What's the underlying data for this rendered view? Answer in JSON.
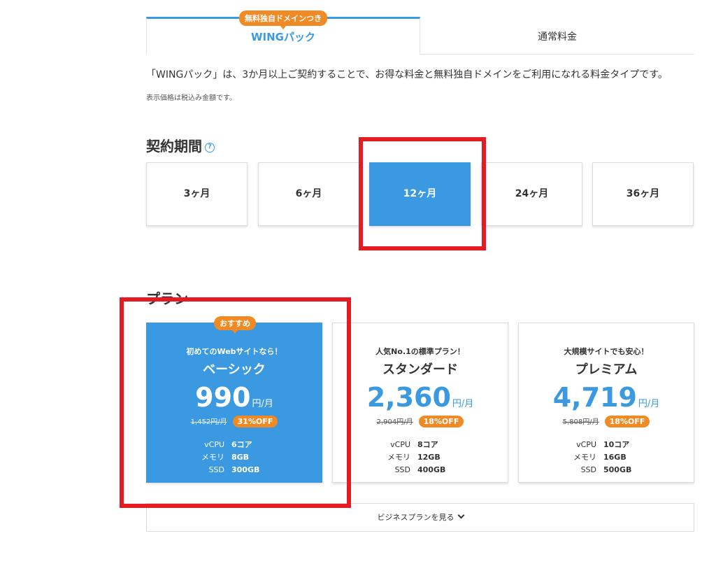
{
  "tabs": {
    "wing": {
      "label": "WINGパック",
      "badge": "無料独自ドメインつき"
    },
    "normal": {
      "label": "通常料金"
    }
  },
  "description": "「WINGパック」は、3か月以上ご契約することで、お得な料金と無料独自ドメインをご利用になれる料金タイプです。",
  "tax_note": "表示価格は税込み金額です。",
  "period_section": {
    "title": "契約期間",
    "help_icon": "?",
    "options": [
      "3ヶ月",
      "6ヶ月",
      "12ヶ月",
      "24ヶ月",
      "36ヶ月"
    ],
    "selected": "12ヶ月"
  },
  "plan_section": {
    "title": "プラン",
    "plans": [
      {
        "badge": "おすすめ",
        "tagline": "初めてのWebサイトなら！",
        "name": "ベーシック",
        "price": "990",
        "unit": "円/月",
        "old_price": "1,452円/月",
        "discount": "31%OFF",
        "specs": [
          {
            "k": "vCPU",
            "v": "6コア"
          },
          {
            "k": "メモリ",
            "v": "8GB"
          },
          {
            "k": "SSD",
            "v": "300GB"
          }
        ]
      },
      {
        "tagline": "人気No.1の標準プラン！",
        "name": "スタンダード",
        "price": "2,360",
        "unit": "円/月",
        "old_price": "2,904円/月",
        "discount": "18%OFF",
        "specs": [
          {
            "k": "vCPU",
            "v": "8コア"
          },
          {
            "k": "メモリ",
            "v": "12GB"
          },
          {
            "k": "SSD",
            "v": "400GB"
          }
        ]
      },
      {
        "tagline": "大規模サイトでも安心！",
        "name": "プレミアム",
        "price": "4,719",
        "unit": "円/月",
        "old_price": "5,808円/月",
        "discount": "18%OFF",
        "specs": [
          {
            "k": "vCPU",
            "v": "10コア"
          },
          {
            "k": "メモリ",
            "v": "16GB"
          },
          {
            "k": "SSD",
            "v": "500GB"
          }
        ]
      }
    ]
  },
  "business_link": "ビジネスプランを見る",
  "colors": {
    "accent": "#3a99e0",
    "badge": "#f08a24",
    "highlight": "#e41b23"
  }
}
